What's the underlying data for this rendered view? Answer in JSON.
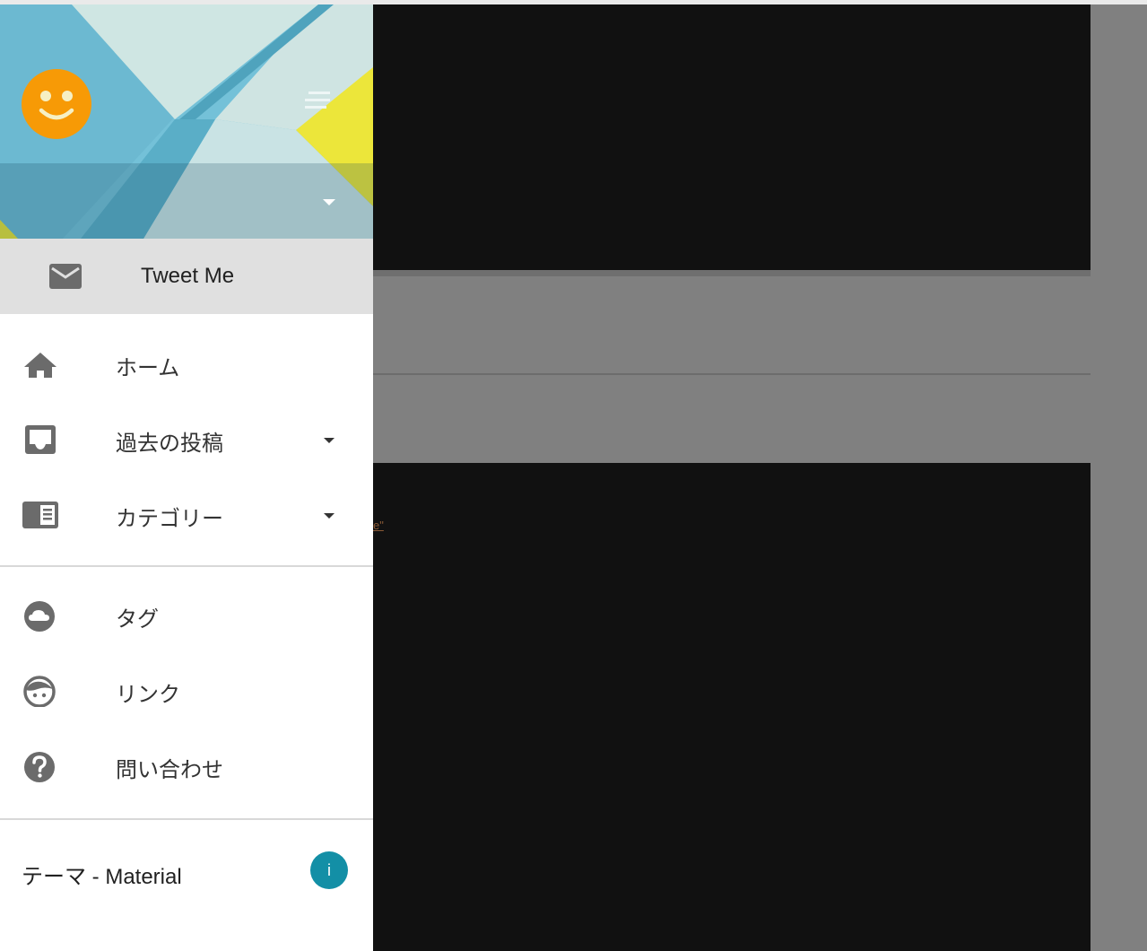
{
  "theme_colors": {
    "accent": "#138fa6",
    "avatar": "#f79a06",
    "header_blue": "#73bfd6",
    "header_yellow": "#ece63a",
    "icon_gray": "#6b6b6b"
  },
  "background_page": {
    "link_fragment": "e\""
  },
  "drawer": {
    "header": {
      "avatar_icon": "smiley-face-icon",
      "menu_icon": "hamburger-menu-icon",
      "account_dropdown_icon": "arrow-drop-down-icon"
    },
    "tweet": {
      "label": "Tweet Me",
      "icon": "mail-icon"
    },
    "nav": [
      {
        "label": "ホーム",
        "icon": "home-icon"
      },
      {
        "label": "過去の投稿",
        "icon": "inbox-icon",
        "has_dropdown": true
      },
      {
        "label": "カテゴリー",
        "icon": "chrome-reader-mode-icon",
        "has_dropdown": true
      },
      {
        "label": "タグ",
        "icon": "cloud-icon"
      },
      {
        "label": "リンク",
        "icon": "face-icon"
      },
      {
        "label": "問い合わせ",
        "icon": "help-icon"
      }
    ],
    "footer": {
      "theme_label": "テーマ - Material",
      "info_badge": "i"
    }
  }
}
